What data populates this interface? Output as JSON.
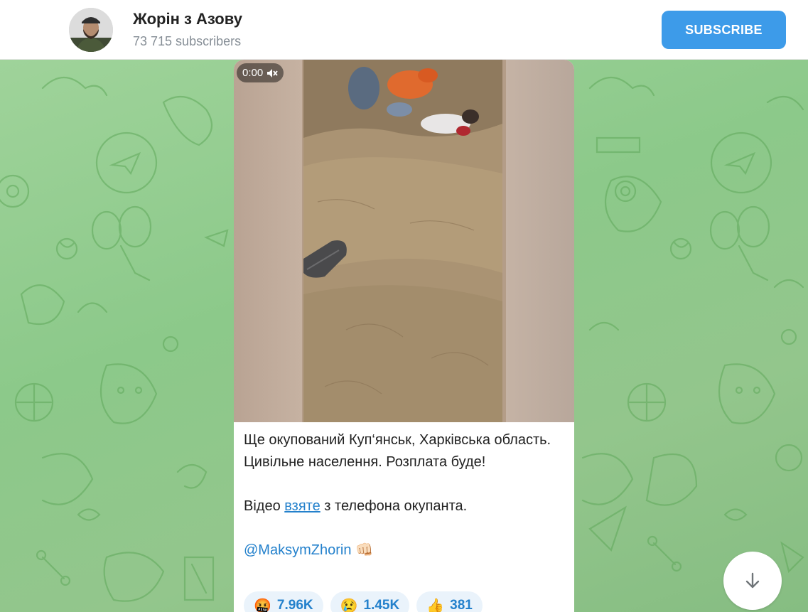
{
  "header": {
    "title": "Жорін з Азову",
    "subscribers": "73 715 subscribers",
    "subscribe_label": "SUBSCRIBE"
  },
  "message": {
    "video_time": "0:00",
    "caption_line1": "Ще окупований Куп‘янськ, Харківська область. Цивільне населення. Розплата буде!",
    "caption_line2_before": "Відео ",
    "caption_line2_link": "взяте",
    "caption_line2_after": " з телефона окупанта.",
    "mention": "@MaksymZhorin",
    "mention_emoji": "👊🏻",
    "reactions": [
      {
        "emoji": "🤬",
        "count": "7.96K"
      },
      {
        "emoji": "😢",
        "count": "1.45K"
      },
      {
        "emoji": "👍",
        "count": "381"
      }
    ]
  },
  "colors": {
    "accent": "#3d9be9",
    "link": "#2481cc",
    "background": "#8fc98a"
  },
  "icons": {
    "mute": "speaker-muted-icon",
    "scroll": "arrow-down-icon"
  }
}
